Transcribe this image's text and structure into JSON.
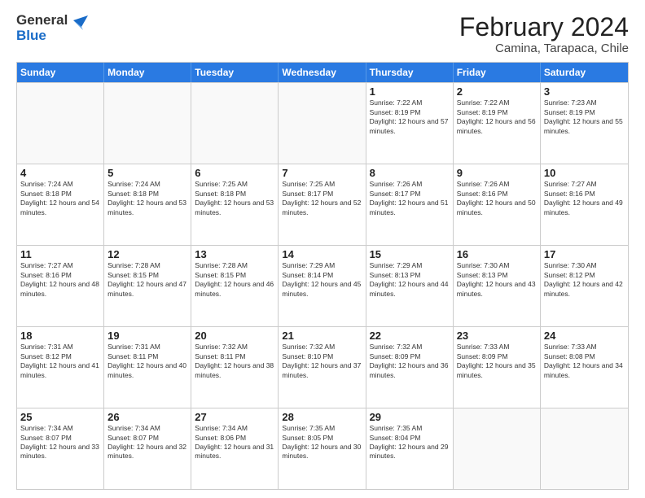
{
  "header": {
    "logo": {
      "general": "General",
      "blue": "Blue"
    },
    "title": "February 2024",
    "location": "Camina, Tarapaca, Chile"
  },
  "weekdays": [
    "Sunday",
    "Monday",
    "Tuesday",
    "Wednesday",
    "Thursday",
    "Friday",
    "Saturday"
  ],
  "weeks": [
    [
      {
        "day": "",
        "sunrise": "",
        "sunset": "",
        "daylight": "",
        "empty": true
      },
      {
        "day": "",
        "sunrise": "",
        "sunset": "",
        "daylight": "",
        "empty": true
      },
      {
        "day": "",
        "sunrise": "",
        "sunset": "",
        "daylight": "",
        "empty": true
      },
      {
        "day": "",
        "sunrise": "",
        "sunset": "",
        "daylight": "",
        "empty": true
      },
      {
        "day": "1",
        "sunrise": "Sunrise: 7:22 AM",
        "sunset": "Sunset: 8:19 PM",
        "daylight": "Daylight: 12 hours and 57 minutes.",
        "empty": false
      },
      {
        "day": "2",
        "sunrise": "Sunrise: 7:22 AM",
        "sunset": "Sunset: 8:19 PM",
        "daylight": "Daylight: 12 hours and 56 minutes.",
        "empty": false
      },
      {
        "day": "3",
        "sunrise": "Sunrise: 7:23 AM",
        "sunset": "Sunset: 8:19 PM",
        "daylight": "Daylight: 12 hours and 55 minutes.",
        "empty": false
      }
    ],
    [
      {
        "day": "4",
        "sunrise": "Sunrise: 7:24 AM",
        "sunset": "Sunset: 8:18 PM",
        "daylight": "Daylight: 12 hours and 54 minutes.",
        "empty": false
      },
      {
        "day": "5",
        "sunrise": "Sunrise: 7:24 AM",
        "sunset": "Sunset: 8:18 PM",
        "daylight": "Daylight: 12 hours and 53 minutes.",
        "empty": false
      },
      {
        "day": "6",
        "sunrise": "Sunrise: 7:25 AM",
        "sunset": "Sunset: 8:18 PM",
        "daylight": "Daylight: 12 hours and 53 minutes.",
        "empty": false
      },
      {
        "day": "7",
        "sunrise": "Sunrise: 7:25 AM",
        "sunset": "Sunset: 8:17 PM",
        "daylight": "Daylight: 12 hours and 52 minutes.",
        "empty": false
      },
      {
        "day": "8",
        "sunrise": "Sunrise: 7:26 AM",
        "sunset": "Sunset: 8:17 PM",
        "daylight": "Daylight: 12 hours and 51 minutes.",
        "empty": false
      },
      {
        "day": "9",
        "sunrise": "Sunrise: 7:26 AM",
        "sunset": "Sunset: 8:16 PM",
        "daylight": "Daylight: 12 hours and 50 minutes.",
        "empty": false
      },
      {
        "day": "10",
        "sunrise": "Sunrise: 7:27 AM",
        "sunset": "Sunset: 8:16 PM",
        "daylight": "Daylight: 12 hours and 49 minutes.",
        "empty": false
      }
    ],
    [
      {
        "day": "11",
        "sunrise": "Sunrise: 7:27 AM",
        "sunset": "Sunset: 8:16 PM",
        "daylight": "Daylight: 12 hours and 48 minutes.",
        "empty": false
      },
      {
        "day": "12",
        "sunrise": "Sunrise: 7:28 AM",
        "sunset": "Sunset: 8:15 PM",
        "daylight": "Daylight: 12 hours and 47 minutes.",
        "empty": false
      },
      {
        "day": "13",
        "sunrise": "Sunrise: 7:28 AM",
        "sunset": "Sunset: 8:15 PM",
        "daylight": "Daylight: 12 hours and 46 minutes.",
        "empty": false
      },
      {
        "day": "14",
        "sunrise": "Sunrise: 7:29 AM",
        "sunset": "Sunset: 8:14 PM",
        "daylight": "Daylight: 12 hours and 45 minutes.",
        "empty": false
      },
      {
        "day": "15",
        "sunrise": "Sunrise: 7:29 AM",
        "sunset": "Sunset: 8:13 PM",
        "daylight": "Daylight: 12 hours and 44 minutes.",
        "empty": false
      },
      {
        "day": "16",
        "sunrise": "Sunrise: 7:30 AM",
        "sunset": "Sunset: 8:13 PM",
        "daylight": "Daylight: 12 hours and 43 minutes.",
        "empty": false
      },
      {
        "day": "17",
        "sunrise": "Sunrise: 7:30 AM",
        "sunset": "Sunset: 8:12 PM",
        "daylight": "Daylight: 12 hours and 42 minutes.",
        "empty": false
      }
    ],
    [
      {
        "day": "18",
        "sunrise": "Sunrise: 7:31 AM",
        "sunset": "Sunset: 8:12 PM",
        "daylight": "Daylight: 12 hours and 41 minutes.",
        "empty": false
      },
      {
        "day": "19",
        "sunrise": "Sunrise: 7:31 AM",
        "sunset": "Sunset: 8:11 PM",
        "daylight": "Daylight: 12 hours and 40 minutes.",
        "empty": false
      },
      {
        "day": "20",
        "sunrise": "Sunrise: 7:32 AM",
        "sunset": "Sunset: 8:11 PM",
        "daylight": "Daylight: 12 hours and 38 minutes.",
        "empty": false
      },
      {
        "day": "21",
        "sunrise": "Sunrise: 7:32 AM",
        "sunset": "Sunset: 8:10 PM",
        "daylight": "Daylight: 12 hours and 37 minutes.",
        "empty": false
      },
      {
        "day": "22",
        "sunrise": "Sunrise: 7:32 AM",
        "sunset": "Sunset: 8:09 PM",
        "daylight": "Daylight: 12 hours and 36 minutes.",
        "empty": false
      },
      {
        "day": "23",
        "sunrise": "Sunrise: 7:33 AM",
        "sunset": "Sunset: 8:09 PM",
        "daylight": "Daylight: 12 hours and 35 minutes.",
        "empty": false
      },
      {
        "day": "24",
        "sunrise": "Sunrise: 7:33 AM",
        "sunset": "Sunset: 8:08 PM",
        "daylight": "Daylight: 12 hours and 34 minutes.",
        "empty": false
      }
    ],
    [
      {
        "day": "25",
        "sunrise": "Sunrise: 7:34 AM",
        "sunset": "Sunset: 8:07 PM",
        "daylight": "Daylight: 12 hours and 33 minutes.",
        "empty": false
      },
      {
        "day": "26",
        "sunrise": "Sunrise: 7:34 AM",
        "sunset": "Sunset: 8:07 PM",
        "daylight": "Daylight: 12 hours and 32 minutes.",
        "empty": false
      },
      {
        "day": "27",
        "sunrise": "Sunrise: 7:34 AM",
        "sunset": "Sunset: 8:06 PM",
        "daylight": "Daylight: 12 hours and 31 minutes.",
        "empty": false
      },
      {
        "day": "28",
        "sunrise": "Sunrise: 7:35 AM",
        "sunset": "Sunset: 8:05 PM",
        "daylight": "Daylight: 12 hours and 30 minutes.",
        "empty": false
      },
      {
        "day": "29",
        "sunrise": "Sunrise: 7:35 AM",
        "sunset": "Sunset: 8:04 PM",
        "daylight": "Daylight: 12 hours and 29 minutes.",
        "empty": false
      },
      {
        "day": "",
        "sunrise": "",
        "sunset": "",
        "daylight": "",
        "empty": true
      },
      {
        "day": "",
        "sunrise": "",
        "sunset": "",
        "daylight": "",
        "empty": true
      }
    ]
  ]
}
